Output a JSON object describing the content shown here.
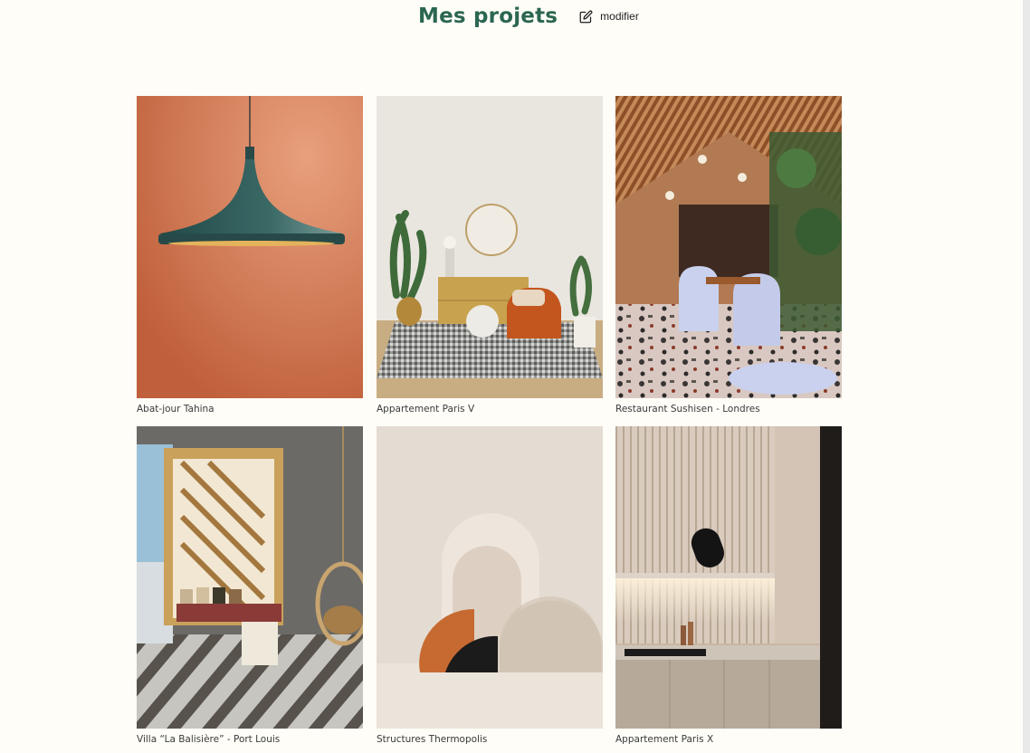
{
  "header": {
    "title": "Mes projets",
    "edit_label": "modifier",
    "edit_icon": "edit-icon"
  },
  "projects": [
    {
      "caption": "Abat-jour Tahina",
      "image": "pendant-lamp-photo"
    },
    {
      "caption": "Appartement Paris V",
      "image": "living-room-photo"
    },
    {
      "caption": "Restaurant Sushisen - Londres",
      "image": "restaurant-photo"
    },
    {
      "caption": "Villa “La Balisière” - Port Louis",
      "image": "villa-photo"
    },
    {
      "caption": "Structures Thermopolis",
      "image": "arch-structures-photo"
    },
    {
      "caption": "Appartement Paris X",
      "image": "kitchen-photo"
    }
  ],
  "colors": {
    "background": "#fefdf8",
    "title": "#2b6651"
  }
}
